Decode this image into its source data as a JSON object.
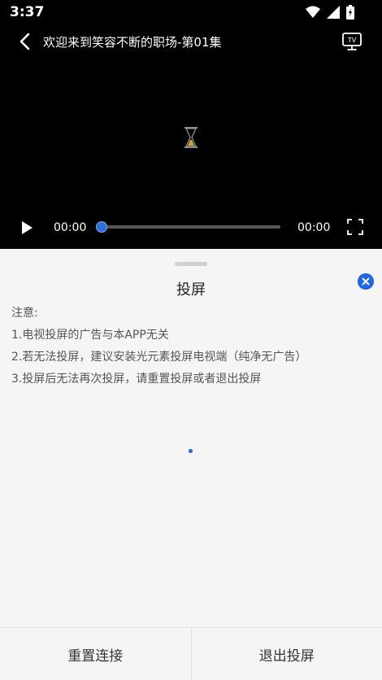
{
  "status": {
    "time": "3:37"
  },
  "player": {
    "title": "欢迎来到笑容不断的职场-第01集",
    "current_time": "00:00",
    "total_time": "00:00",
    "progress": 0
  },
  "icons": {
    "wifi": "wifi-icon",
    "signal": "signal-icon",
    "battery": "battery-icon",
    "back": "back-chevron-icon",
    "tv": "tv-cast-icon",
    "hourglass": "hourglass-icon",
    "play": "play-icon",
    "fullscreen": "fullscreen-icon",
    "close": "close-icon"
  },
  "sheet": {
    "title": "投屏",
    "notes": [
      "注意:",
      "1.电视投屏的广告与本APP无关",
      "2.若无法投屏，建议安装光元素投屏电视端（纯净无广告）",
      "3.投屏后无法再次投屏，请重置投屏或者退出投屏"
    ],
    "buttons": {
      "reset": "重置连接",
      "exit": "退出投屏"
    }
  },
  "colors": {
    "accent": "#1e66e6",
    "background": "#000000",
    "sheet": "#f5f5f5"
  }
}
